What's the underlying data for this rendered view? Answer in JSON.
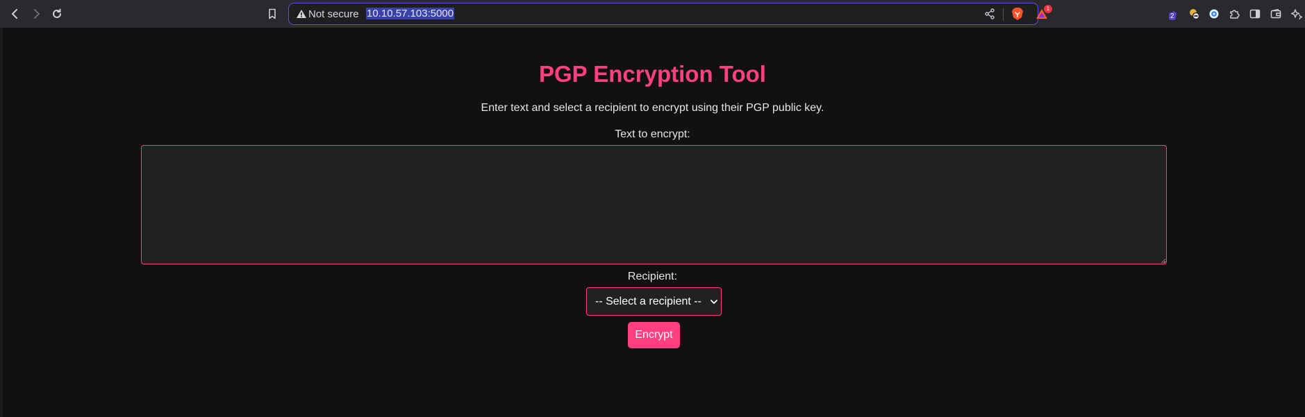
{
  "browser": {
    "security_label": "Not secure",
    "url": "10.10.57.103:5000",
    "rewards_count": "1",
    "extension_count": "2",
    "accent_color": "#5b4ee0"
  },
  "page": {
    "title": "PGP Encryption Tool",
    "intro": "Enter text and select a recipient to encrypt using their PGP public key.",
    "text_label": "Text to encrypt:",
    "text_value": "",
    "recipient_label": "Recipient:",
    "recipient_selected": "-- Select a recipient --",
    "encrypt_label": "Encrypt",
    "accent_color": "#ff3f7f",
    "background_color": "#111113"
  },
  "icons": [
    "back-icon",
    "forward-icon",
    "reload-icon",
    "bookmark-icon",
    "warning-icon",
    "share-icon",
    "brave-shield-icon",
    "brave-rewards-icon",
    "extension-icon",
    "puzzle-icon",
    "sidebar-icon",
    "wallet-icon",
    "leo-ai-icon",
    "chevron-down-icon"
  ]
}
